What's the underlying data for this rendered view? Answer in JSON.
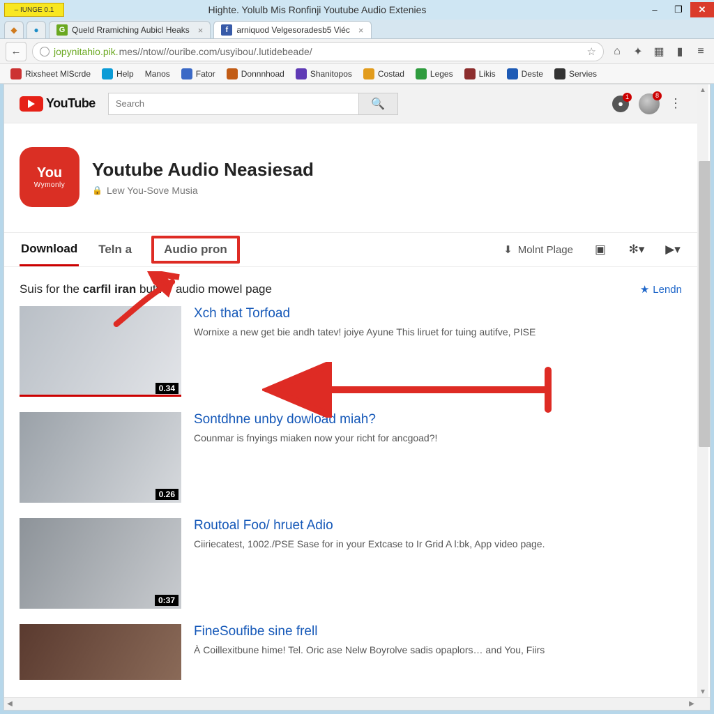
{
  "window": {
    "app_tag": "– IUNGE 0.1",
    "title": "Highte. Yolulb Mis Ronfinji Youtube Audio Extenies",
    "min_label": "–",
    "max_label": "❐",
    "close_label": "✕"
  },
  "tabs": {
    "mini1_icon": "◆",
    "mini2_icon": "●",
    "t1_label": "Queld Rramiching Aubicl Heaks",
    "t1_fav": "G",
    "t2_label": "arniquod Velgesoradesb5 Viéc",
    "t2_fav": "f",
    "close_x": "×"
  },
  "addr": {
    "back": "←",
    "host": "jopynitahio.pik.",
    "rest": "mes//ntow//ouribe.com/usyibou/.lutidebeade/",
    "star": "☆"
  },
  "addr_icons": {
    "i1": "⌂",
    "i2": "✦",
    "i3": "▦",
    "i4": "▮",
    "i5": "≡"
  },
  "bookmarks": {
    "b1": "Rixsheet MlScrde",
    "b2": "Help",
    "b3": "Manos",
    "b4": "Fator",
    "b5": "Donnnhoad",
    "b6": "Shanitopos",
    "b7": "Costad",
    "b8": "Leges",
    "b9": "Likis",
    "b10": "Deste",
    "b11": "Servies"
  },
  "yt": {
    "brand": "YouTube",
    "search_placeholder": "Search",
    "bell_badge": "1",
    "avatar_badge": "8",
    "kebab": "⋮"
  },
  "channel": {
    "logo_l1": "You",
    "logo_l2": "Wymonly",
    "title": "Youtube Audio Neasiesad",
    "subtitle": "Lew You-Sove Musia",
    "lock": "🔒"
  },
  "chtabs": {
    "t1": "Download",
    "t2": "Teln a",
    "t3": "Audio pron",
    "action_dl": "Molnt Plage",
    "dl_icon": "⬇",
    "i1": "▣",
    "i2": "✻▾",
    "i3": "▶▾"
  },
  "subhead": {
    "text_pre": "Suis for the ",
    "text_b": "carfil iran",
    "text_post": " buttior audio mowel page",
    "lendn": "Lendn",
    "star": "★"
  },
  "videos": [
    {
      "title": "Xch that Torfoad",
      "desc": "Wornixe a new get bie andh tatev! joiye Ayune This liruet for tuing autifve, PISE",
      "dur": "0.34"
    },
    {
      "title": "Sontdhne unby dowload miah?",
      "desc": "Counmar is fnyings miaken now your richt for ancgoad?!",
      "dur": "0.26"
    },
    {
      "title": "Routoal Foo/ hruet Adio",
      "desc": "Ciiriecatest, 1002./PSE Sase for in your Extcase to Ir Grid A l:bk, App video page.",
      "dur": "0:37"
    },
    {
      "title": "FineSoufibe sine frell",
      "desc": "À Coillexitbune hime! Tel. Oric ase Nelw Boyrolve sadis opaplors… and You, Fiirs",
      "dur": ""
    }
  ]
}
